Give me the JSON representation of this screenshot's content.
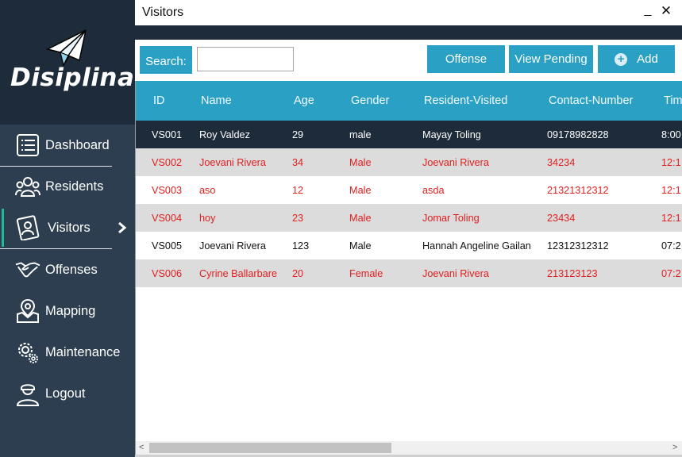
{
  "brand": {
    "logo_text": "Disiplina"
  },
  "sidebar": {
    "items": [
      {
        "label": "Dashboard",
        "icon": "dashboard-list-icon"
      },
      {
        "label": "Residents",
        "icon": "people-group-icon"
      },
      {
        "label": "Visitors",
        "icon": "id-card-icon",
        "active": true
      },
      {
        "label": "Offenses",
        "icon": "handshake-icon"
      },
      {
        "label": "Mapping",
        "icon": "map-pin-icon"
      },
      {
        "label": "Maintenance",
        "icon": "gears-icon"
      },
      {
        "label": "Logout",
        "icon": "officer-icon"
      }
    ],
    "active_indicator_icon": "chevron-right-icon"
  },
  "window": {
    "title": "Visitors",
    "minimize": "_",
    "close": "✕"
  },
  "toolbar": {
    "search_label": "Search:",
    "search_value": "",
    "offense_label": "Offense",
    "view_pending_label": "View Pending",
    "add_label": "Add"
  },
  "table": {
    "columns": [
      "ID",
      "Name",
      "Age",
      "Gender",
      "Resident-Visited",
      "Contact-Number",
      "Tim"
    ],
    "rows": [
      {
        "id": "VS001",
        "name": "Roy Valdez",
        "age": "29",
        "gender": "male",
        "resident": "Mayay Toling",
        "contact": "09178982828",
        "time": "8:00"
      },
      {
        "id": "VS002",
        "name": "Joevani Rivera",
        "age": "34",
        "gender": "Male",
        "resident": "Joevani Rivera",
        "contact": "34234",
        "time": "12:1"
      },
      {
        "id": "VS003",
        "name": "aso",
        "age": "12",
        "gender": "Male",
        "resident": "asda",
        "contact": "21321312312",
        "time": "12:1"
      },
      {
        "id": "VS004",
        "name": "hoy",
        "age": "23",
        "gender": "Male",
        "resident": "Jomar Toling",
        "contact": "23434",
        "time": "12:1"
      },
      {
        "id": "VS005",
        "name": "Joevani Rivera",
        "age": "123",
        "gender": "Male",
        "resident": "Hannah Angeline Gailan",
        "contact": "12312312312",
        "time": "07:2"
      },
      {
        "id": "VS006",
        "name": "Cyrine Ballarbare",
        "age": "20",
        "gender": "Female",
        "resident": "Joevani Rivera",
        "contact": "213123123",
        "time": "07:2"
      }
    ]
  },
  "scrollbar": {
    "left_arrow": "<",
    "right_arrow": ">"
  },
  "colors": {
    "sidebar": "#2c3e50",
    "accent": "#2aa0c4",
    "selected_row": "#1d2b3a",
    "pending_text": "#e02020",
    "active_marker": "#1abc9c"
  }
}
